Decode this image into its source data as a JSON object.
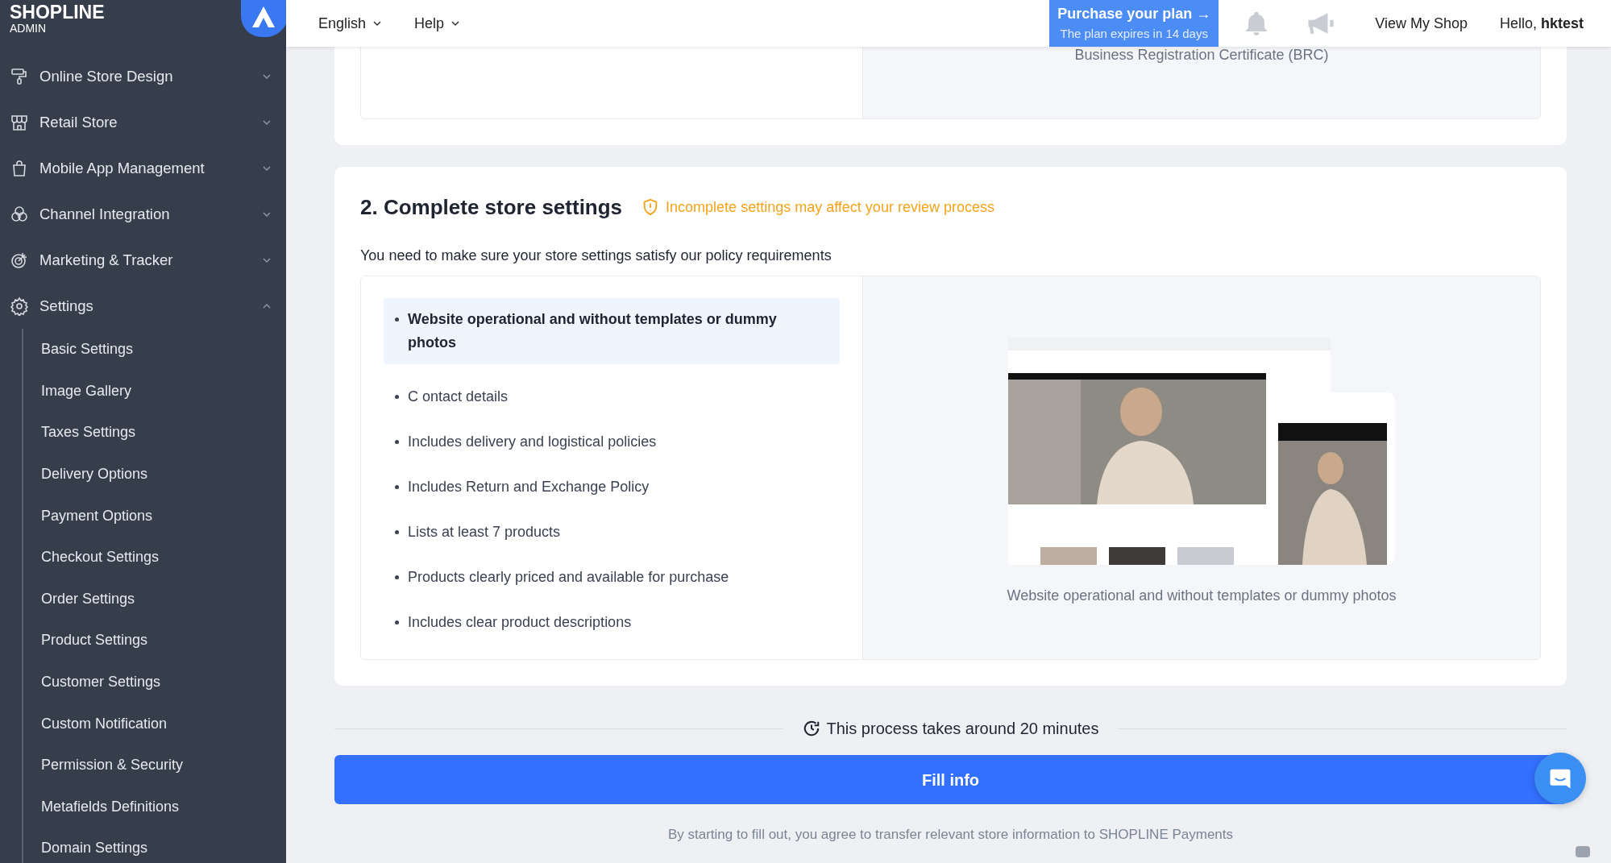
{
  "sidebar": {
    "brand": "SHOPLINE",
    "brand_sub": "ADMIN",
    "items": [
      {
        "label": "Online Store Design",
        "expanded": false
      },
      {
        "label": "Retail Store",
        "expanded": false
      },
      {
        "label": "Mobile App Management",
        "expanded": false
      },
      {
        "label": "Channel Integration",
        "expanded": false
      },
      {
        "label": "Marketing & Tracker",
        "expanded": false
      },
      {
        "label": "Settings",
        "expanded": true,
        "children": [
          {
            "label": "Basic Settings"
          },
          {
            "label": "Image Gallery"
          },
          {
            "label": "Taxes Settings"
          },
          {
            "label": "Delivery Options"
          },
          {
            "label": "Payment Options"
          },
          {
            "label": "Checkout Settings"
          },
          {
            "label": "Order Settings"
          },
          {
            "label": "Product Settings"
          },
          {
            "label": "Customer Settings"
          },
          {
            "label": "Custom Notification"
          },
          {
            "label": "Permission & Security"
          },
          {
            "label": "Metafields Definitions"
          },
          {
            "label": "Domain Settings"
          }
        ]
      }
    ]
  },
  "topbar": {
    "language": "English",
    "help": "Help",
    "purchase": {
      "title": "Purchase your plan →",
      "subtitle": "The plan expires in 14 days"
    },
    "view_shop": "View My Shop",
    "greeting": "Hello, **hktest**"
  },
  "previous_card": {
    "caption": "Business Registration Certificate (BRC)"
  },
  "section": {
    "title": "2. Complete store settings",
    "warning": "Incomplete settings may affect your review process",
    "description": "You need to make sure your store settings satisfy our policy requirements",
    "requirements": [
      {
        "text": "Website operational and without templates or dummy photos",
        "selected": true
      },
      {
        "text": "C ontact details",
        "selected": false
      },
      {
        "text": "Includes delivery and logistical policies",
        "selected": false
      },
      {
        "text": "Includes Return and Exchange Policy",
        "selected": false
      },
      {
        "text": "Lists at least 7 products",
        "selected": false
      },
      {
        "text": "Products clearly priced and available for purchase",
        "selected": false
      },
      {
        "text": "Includes clear product descriptions",
        "selected": false
      }
    ],
    "preview": {
      "kind": "picture",
      "caption": "Website operational and without templates or dummy photos"
    }
  },
  "footer": {
    "duration": "This process takes around 20 minutes",
    "button": "Fill info",
    "note": "By starting to fill out, you agree to transfer relevant store information to SHOPLINE Payments"
  }
}
